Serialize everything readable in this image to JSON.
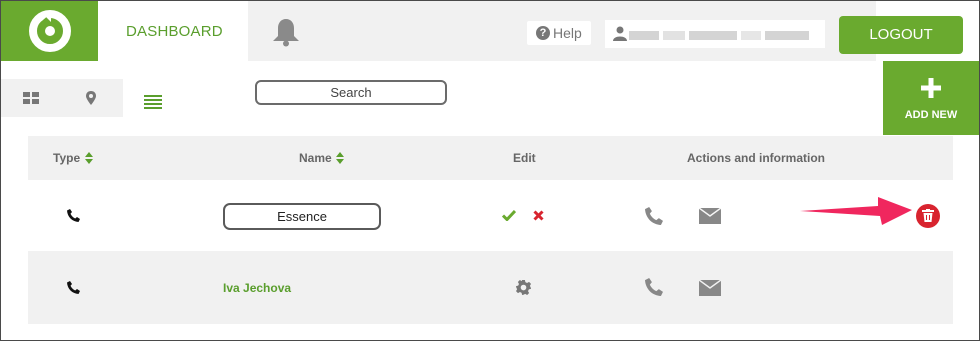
{
  "header": {
    "logo": "logo-icon",
    "dashboard_tab": "DASHBOARD",
    "notifications_icon": "bell-icon",
    "help_label": "Help",
    "user_icon": "user-icon",
    "logout_label": "LOGOUT"
  },
  "toolbar": {
    "views": [
      "grid-view-icon",
      "map-pin-icon",
      "list-view-icon"
    ],
    "active_view": "list",
    "search_placeholder": "Search",
    "add_new_label": "ADD NEW"
  },
  "table": {
    "columns": [
      "Type",
      "Name",
      "Edit",
      "Actions and information"
    ],
    "rows": [
      {
        "type_icon": "phone-icon",
        "name": "Essence",
        "editing": true,
        "edit_icons": [
          "check-icon",
          "cancel-icon"
        ],
        "action_icons": [
          "phone-icon",
          "envelope-icon",
          "trash-icon"
        ]
      },
      {
        "type_icon": "phone-icon",
        "name": "Iva Jechova",
        "editing": false,
        "edit_icons": [
          "gear-icon"
        ],
        "action_icons": [
          "phone-icon",
          "envelope-icon"
        ]
      }
    ]
  },
  "colors": {
    "brand_green": "#6aaa2f",
    "delete_red": "#d8242f",
    "arrow_pink": "#f0275e"
  }
}
